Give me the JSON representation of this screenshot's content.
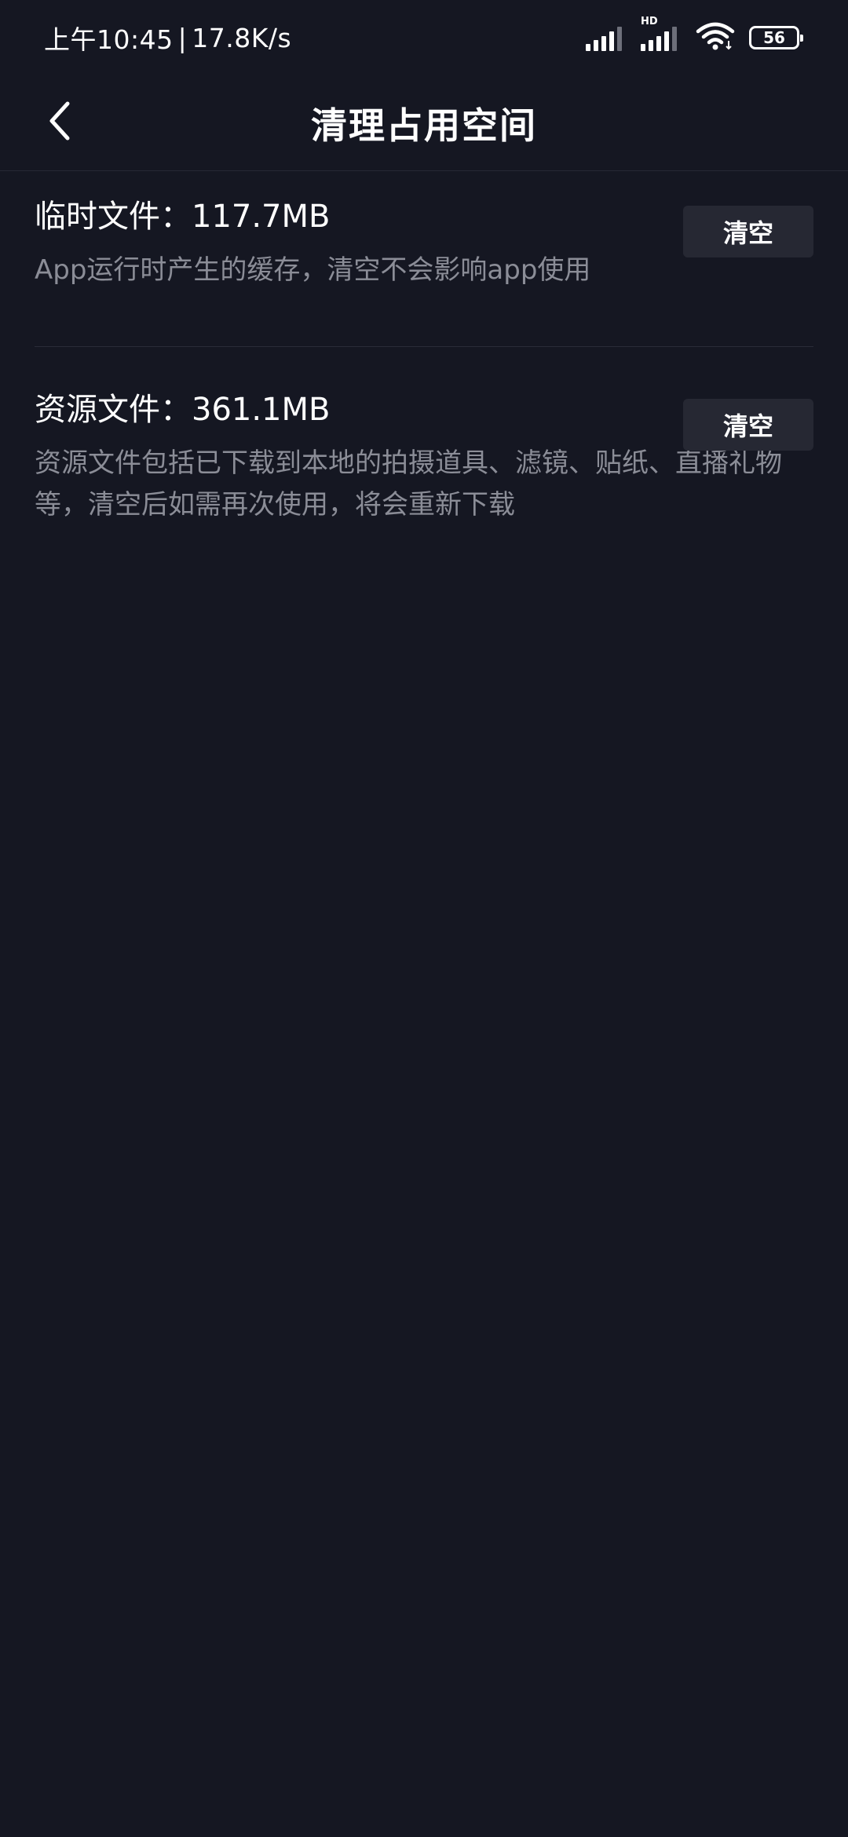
{
  "status_bar": {
    "time": "上午10:45",
    "separator": "|",
    "speed": "17.8K/s",
    "hd_label": "HD",
    "battery": "56",
    "icons": [
      "signal-icon",
      "signal-hd-icon",
      "wifi-icon",
      "battery-icon"
    ]
  },
  "nav": {
    "title": "清理占用空间",
    "back_icon": "chevron-left-icon"
  },
  "sections": [
    {
      "title": "临时文件：117.7MB",
      "description": "App运行时产生的缓存，清空不会影响app使用",
      "button_label": "清空"
    },
    {
      "title": "资源文件：361.1MB",
      "description": "资源文件包括已下载到本地的拍摄道具、滤镜、贴纸、直播礼物等，清空后如需再次使用，将会重新下载",
      "button_label": "清空"
    }
  ],
  "colors": {
    "background": "#151722",
    "button_bg": "#262833",
    "secondary_text": "#8b8d97",
    "divider": "#2a2c38"
  }
}
